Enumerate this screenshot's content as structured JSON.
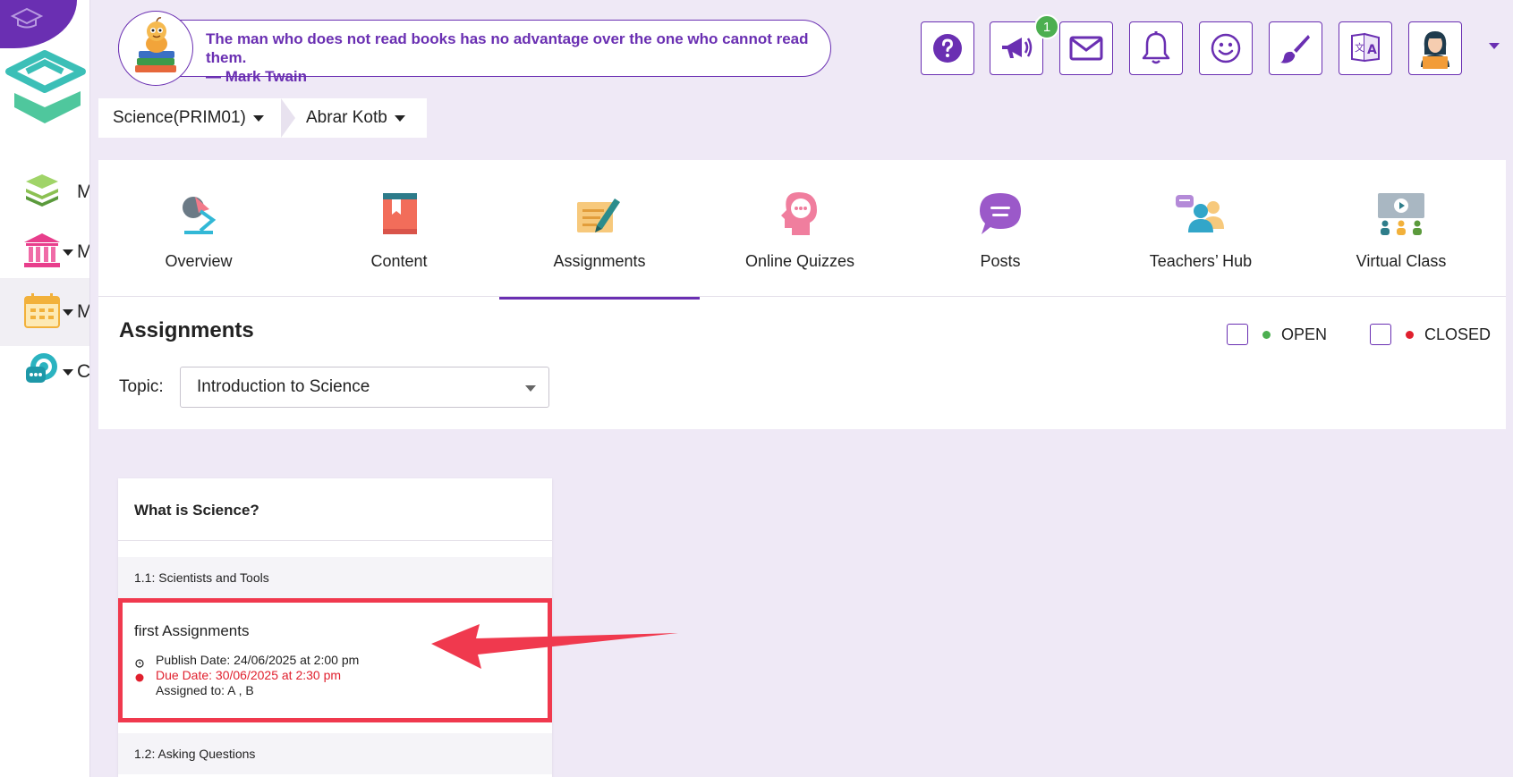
{
  "header": {
    "quote_line1": "The man who does not read books has no advantage over the one who cannot read them.",
    "quote_line2": "— Mark Twain",
    "buttons": [
      "help-icon",
      "megaphone-icon",
      "mail-icon",
      "bell-icon",
      "smiley-icon",
      "brush-icon",
      "translate-icon",
      "profile-avatar"
    ],
    "announcement_count": "1"
  },
  "sidebar": {
    "items": [
      {
        "icon": "books-icon",
        "label": "M"
      },
      {
        "icon": "institution-icon",
        "label": "M"
      },
      {
        "icon": "calendar-icon",
        "label": "M"
      },
      {
        "icon": "chat-icon",
        "label": "C"
      }
    ]
  },
  "breadcrumb": {
    "course": "Science(PRIM01)",
    "teacher": "Abrar Kotb"
  },
  "tabs": [
    {
      "label": "Overview",
      "icon": "overview-icon"
    },
    {
      "label": "Content",
      "icon": "book-icon"
    },
    {
      "label": "Assignments",
      "icon": "assignment-icon",
      "active": true
    },
    {
      "label": "Online Quizzes",
      "icon": "quiz-head-icon"
    },
    {
      "label": "Posts",
      "icon": "speech-bubble-icon"
    },
    {
      "label": "Teachers’ Hub",
      "icon": "people-icon"
    },
    {
      "label": "Virtual Class",
      "icon": "virtual-class-icon"
    }
  ],
  "assignments_section": {
    "title": "Assignments",
    "legend_open": "OPEN",
    "legend_closed": "CLOSED",
    "topic_label": "Topic:",
    "topic_value": "Introduction to Science"
  },
  "card": {
    "title": "What is Science?",
    "subtopic1": "1.1: Scientists and Tools",
    "subtopic2": "1.2: Asking Questions",
    "assignment": {
      "name": "first Assignments",
      "publish": "Publish Date: 24/06/2025 at 2:00 pm",
      "due": "Due Date: 30/06/2025 at 2:30 pm",
      "assigned": "Assigned to: A , B"
    }
  },
  "colors": {
    "brand": "#6a2fb2",
    "open": "#4caf50",
    "closed": "#e0202e",
    "highlight": "#f0394e"
  }
}
